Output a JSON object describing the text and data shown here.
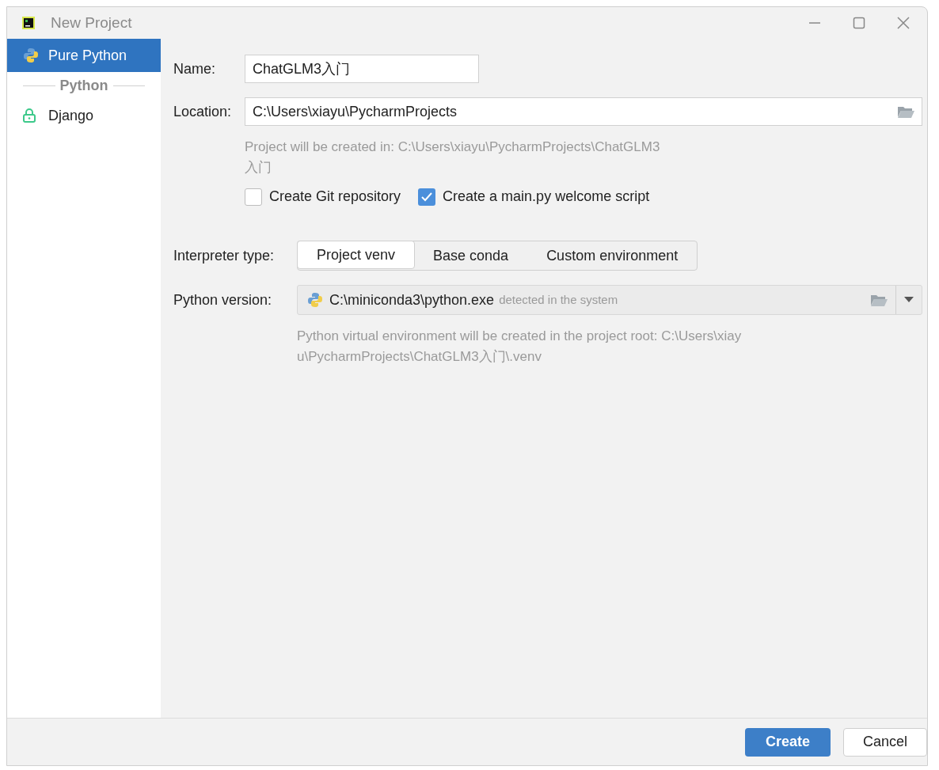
{
  "window": {
    "title": "New Project"
  },
  "sidebar": {
    "items": [
      {
        "kind": "python",
        "label": "Pure Python",
        "selected": true
      },
      {
        "kind": "group",
        "label": "Python"
      },
      {
        "kind": "locked",
        "label": "Django",
        "selected": false
      }
    ]
  },
  "form": {
    "name": {
      "label": "Name:",
      "value": "ChatGLM3入门"
    },
    "location": {
      "label": "Location:",
      "value": "C:\\Users\\xiayu\\PycharmProjects"
    },
    "location_hint": "Project will be created in: C:\\Users\\xiayu\\PycharmProjects\\ChatGLM3入门",
    "checkboxes": [
      {
        "label": "Create Git repository",
        "checked": false
      },
      {
        "label": "Create a main.py welcome script",
        "checked": true
      }
    ],
    "interpreter_type": {
      "label": "Interpreter type:",
      "options": [
        {
          "label": "Project venv",
          "selected": true
        },
        {
          "label": "Base conda",
          "selected": false
        },
        {
          "label": "Custom environment",
          "selected": false
        }
      ]
    },
    "python_version": {
      "label": "Python version:",
      "value": "C:\\miniconda3\\python.exe",
      "note": "detected in the system"
    },
    "venv_hint": "Python virtual environment will be created in the project root: C:\\Users\\xiayu\\PycharmProjects\\ChatGLM3入门\\.venv"
  },
  "buttons": [
    {
      "label": "Create",
      "kind": "primary"
    },
    {
      "label": "Cancel",
      "kind": "secondary"
    }
  ]
}
